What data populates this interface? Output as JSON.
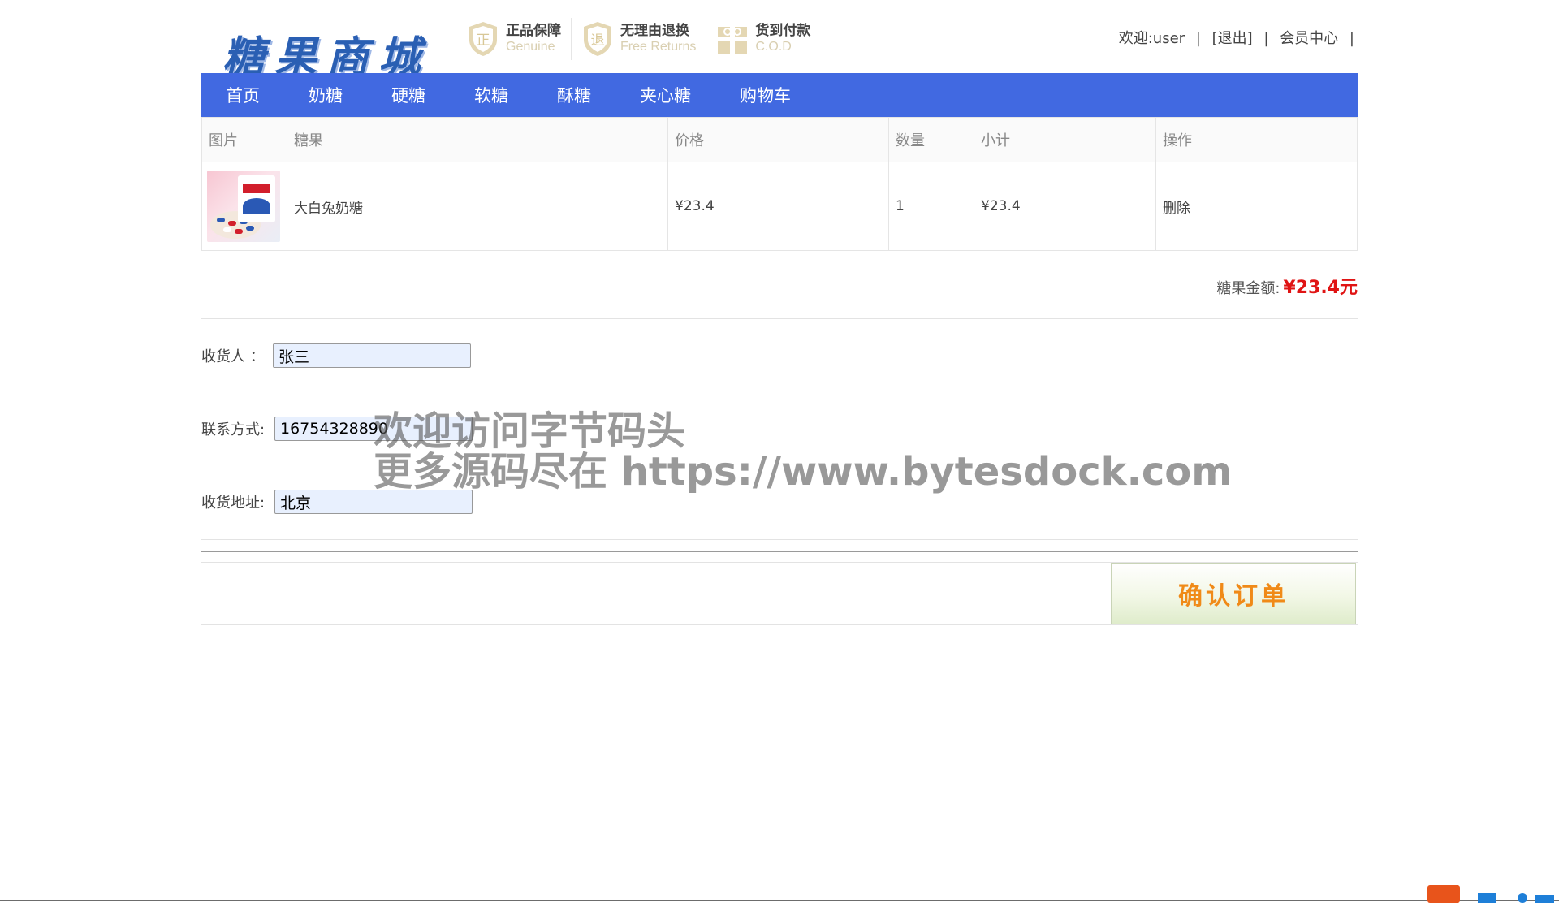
{
  "header": {
    "logo_text": "糖果商城",
    "badges": [
      {
        "icon": "genuine-shield-icon",
        "title": "正品保障",
        "subtitle": "Genuine"
      },
      {
        "icon": "free-returns-shield-icon",
        "title": "无理由退换",
        "subtitle": "Free Returns"
      },
      {
        "icon": "gift-box-icon",
        "title": "货到付款",
        "subtitle": "C.O.D"
      }
    ],
    "welcome": "欢迎:user",
    "sep": "|",
    "logout": "[退出]",
    "member_center": "会员中心"
  },
  "nav": [
    "首页",
    "奶糖",
    "硬糖",
    "软糖",
    "酥糖",
    "夹心糖",
    "购物车"
  ],
  "cart": {
    "columns": [
      "图片",
      "糖果",
      "价格",
      "数量",
      "小计",
      "操作"
    ],
    "rows": [
      {
        "name": "大白兔奶糖",
        "price": "¥23.4",
        "qty": "1",
        "subtotal": "¥23.4",
        "action": "删除"
      }
    ],
    "total_label": "糖果金额:",
    "total_value": "¥23.4元"
  },
  "form": {
    "receiver_label": "收货人   ：",
    "receiver_value": "张三",
    "phone_label": "联系方式:",
    "phone_value": "16754328890",
    "address_label": "收货地址:",
    "address_value": "北京"
  },
  "confirm_label": "确认订单",
  "watermark": {
    "line1": "欢迎访问字节码头",
    "line2": "更多源码尽在  https://www.bytesdock.com"
  },
  "colors": {
    "nav_bg": "#4169e1",
    "price_red": "#e01414",
    "confirm_text": "#f08a18"
  }
}
